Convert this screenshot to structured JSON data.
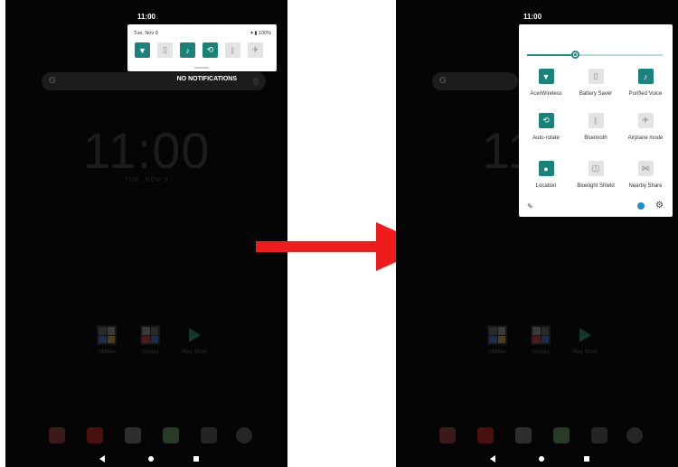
{
  "left_screen": {
    "status_time": "11:00",
    "clock": "11:00",
    "date": "TUE, NOV 9",
    "no_notifications": "NO NOTIFICATIONS",
    "shade": {
      "date": "Tue, Nov 9",
      "battery": "100%",
      "tiles": [
        {
          "icon": "wifi-icon",
          "active": true
        },
        {
          "icon": "battery-saver-icon",
          "active": false
        },
        {
          "icon": "purified-voice-icon",
          "active": true
        },
        {
          "icon": "auto-rotate-icon",
          "active": true
        },
        {
          "icon": "bluetooth-icon",
          "active": false
        },
        {
          "icon": "airplane-icon",
          "active": false
        }
      ]
    },
    "folders": [
      {
        "label": "Utilities"
      },
      {
        "label": "Google"
      },
      {
        "label": "Play Store"
      }
    ]
  },
  "right_screen": {
    "status_time": "11:00",
    "quick_settings": {
      "brightness_level": 0.35,
      "tiles": [
        {
          "label": "AcerWireless",
          "icon": "wifi-icon",
          "active": true
        },
        {
          "label": "Battery Saver",
          "icon": "battery-saver-icon",
          "active": false
        },
        {
          "label": "Purified Voice",
          "icon": "purified-voice-icon",
          "active": true
        },
        {
          "label": "Auto-rotate",
          "icon": "auto-rotate-icon",
          "active": true
        },
        {
          "label": "Bluetooth",
          "icon": "bluetooth-icon",
          "active": false
        },
        {
          "label": "Airplane mode",
          "icon": "airplane-icon",
          "active": false
        },
        {
          "label": "Location",
          "icon": "location-icon",
          "active": true
        },
        {
          "label": "Bluelight Shield",
          "icon": "bluelight-shield-icon",
          "active": false
        },
        {
          "label": "Nearby Share",
          "icon": "nearby-share-icon",
          "active": false
        }
      ]
    },
    "clock_fragment": "11",
    "folders": [
      {
        "label": "Utilities"
      },
      {
        "label": "Google"
      },
      {
        "label": "Play Store"
      }
    ]
  },
  "colors": {
    "accent": "#1a8379",
    "arrow": "#ee1c1c",
    "background": "#050505"
  }
}
